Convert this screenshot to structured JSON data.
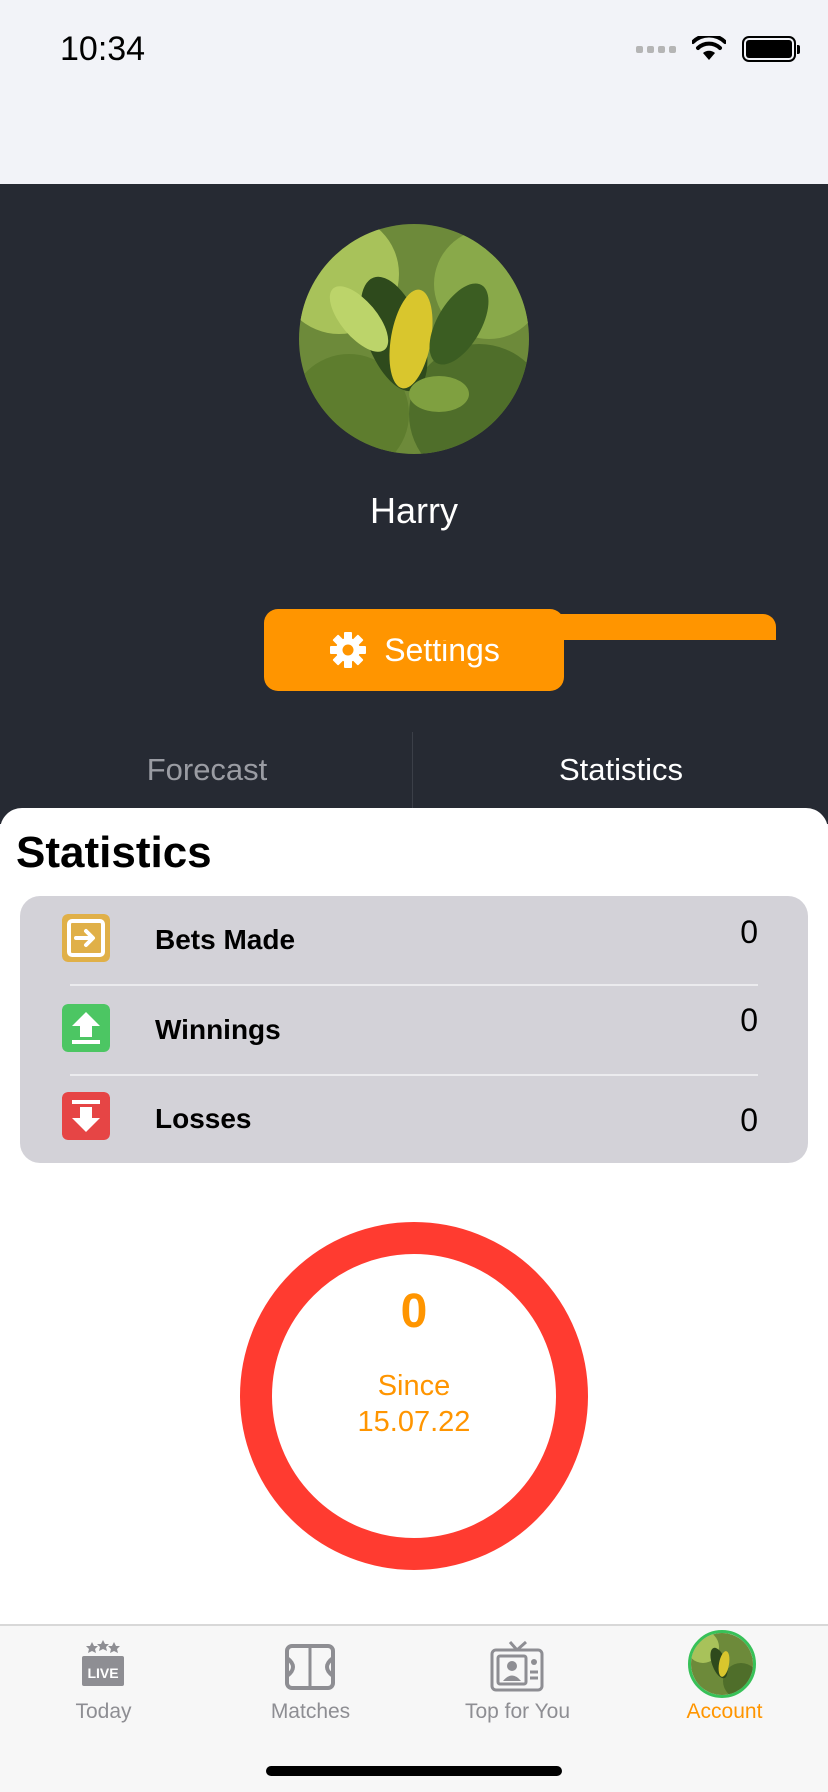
{
  "status": {
    "time": "10:34"
  },
  "profile": {
    "name": "Harry",
    "settings_label": "Settings"
  },
  "tabs": {
    "forecast": "Forecast",
    "statistics": "Statistics"
  },
  "statistics": {
    "title": "Statistics",
    "rows": [
      {
        "label": "Bets Made",
        "value": "0",
        "icon": "enter-icon",
        "color": "#e0b048"
      },
      {
        "label": "Winnings",
        "value": "0",
        "icon": "upload-arrow-icon",
        "color": "#4cc663"
      },
      {
        "label": "Losses",
        "value": "0",
        "icon": "download-arrow-icon",
        "color": "#e64545"
      }
    ],
    "ring": {
      "value": "0",
      "since_label": "Since",
      "since_date": "15.07.22",
      "color": "#ff3b30"
    }
  },
  "tabbar": [
    {
      "label": "Today",
      "icon": "live-tv-icon"
    },
    {
      "label": "Matches",
      "icon": "pitch-icon"
    },
    {
      "label": "Top for You",
      "icon": "retro-tv-icon"
    },
    {
      "label": "Account",
      "icon": "avatar"
    }
  ],
  "colors": {
    "accent": "#ff9500",
    "header_bg": "#262a33"
  }
}
